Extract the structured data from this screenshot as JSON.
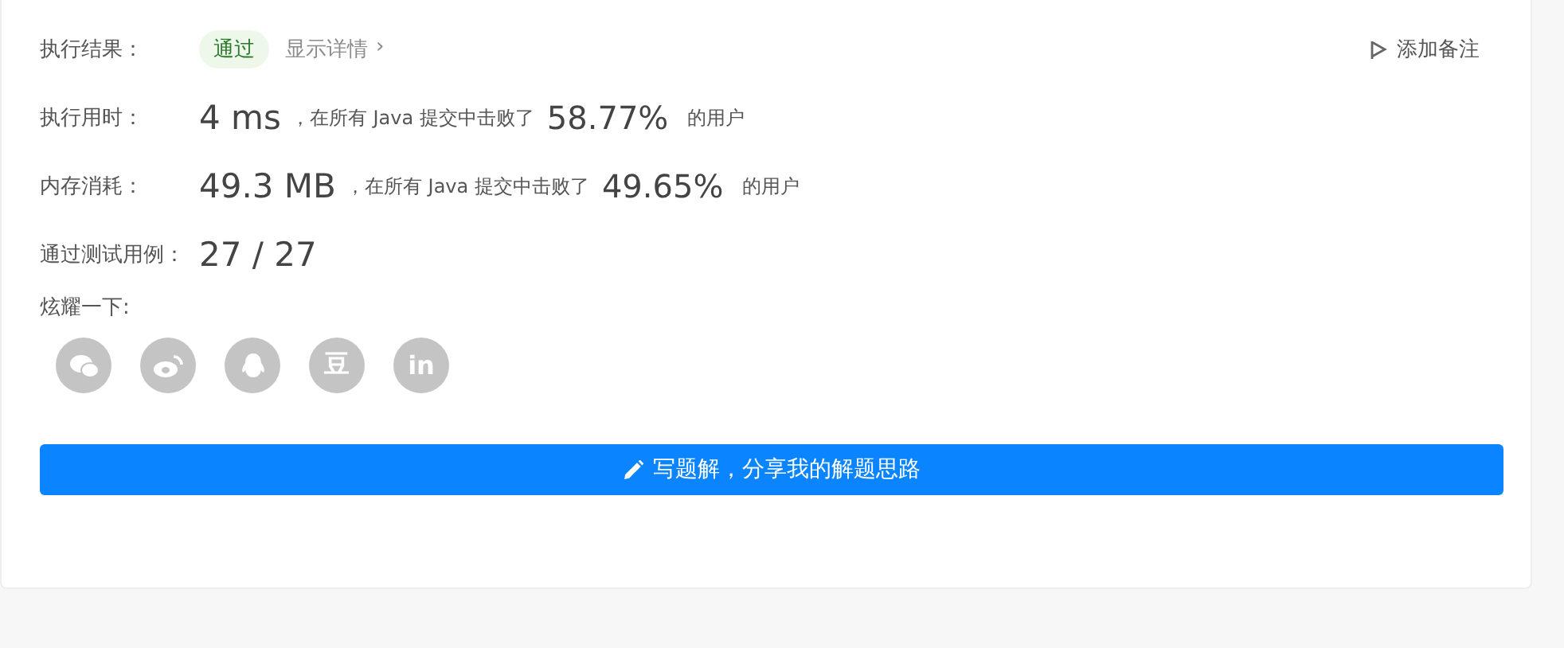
{
  "result": {
    "label": "执行结果：",
    "status": "通过",
    "passed": true,
    "details_link": "显示详情",
    "details_arrow": "›"
  },
  "add_note": "添加备注",
  "stats": [
    {
      "label": "执行用时：",
      "value": "4 ms",
      "middle": "，在所有 Java 提交中击败了",
      "percent": "58.77%",
      "suffix": "的用户"
    },
    {
      "label": "内存消耗：",
      "value": "49.3 MB",
      "middle": "，在所有 Java 提交中击败了",
      "percent": "49.65%",
      "suffix": "的用户"
    }
  ],
  "tests": {
    "label": "通过测试用例：",
    "value": "27 / 27"
  },
  "share": {
    "label": "炫耀一下:",
    "items": [
      {
        "kind": "wechat"
      },
      {
        "kind": "weibo"
      },
      {
        "kind": "qq"
      },
      {
        "kind": "text",
        "text": "豆"
      },
      {
        "kind": "text",
        "text": "in"
      }
    ]
  },
  "write_button": "写题解，分享我的解题思路"
}
